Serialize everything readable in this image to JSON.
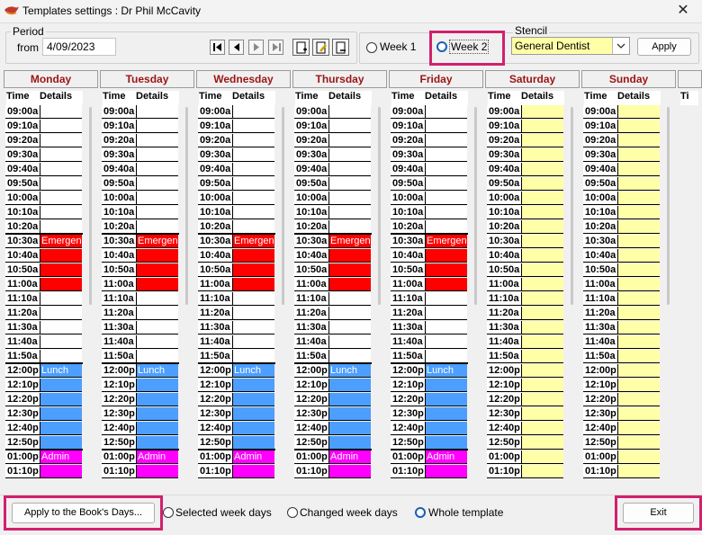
{
  "window": {
    "title": "Templates settings : Dr Phil McCavity",
    "close_glyph": "✕"
  },
  "period": {
    "label": "Period",
    "from_label": "from",
    "from_value": "4/09/2023"
  },
  "week_options": [
    {
      "label": "Week 1",
      "selected": false
    },
    {
      "label": "Week 2",
      "selected": true
    }
  ],
  "stencil": {
    "label": "Stencil",
    "value": "General Dentist",
    "apply_label": "Apply"
  },
  "columns": {
    "time": "Time",
    "details": "Details"
  },
  "days": [
    "Monday",
    "Tuesday",
    "Wednesday",
    "Thursday",
    "Friday",
    "Saturday",
    "Sunday"
  ],
  "partial_day_header": "Ti",
  "times": [
    "09:00a",
    "09:10a",
    "09:20a",
    "09:30a",
    "09:40a",
    "09:50a",
    "10:00a",
    "10:10a",
    "10:20a",
    "10:30a",
    "10:40a",
    "10:50a",
    "11:00a",
    "11:10a",
    "11:20a",
    "11:30a",
    "11:40a",
    "11:50a",
    "12:00p",
    "12:10p",
    "12:20p",
    "12:30p",
    "12:40p",
    "12:50p",
    "01:00p",
    "01:10p"
  ],
  "blocks": [
    {
      "label": "Emergency",
      "start": 9,
      "end": 12,
      "color": "#ff0000"
    },
    {
      "label": "Lunch",
      "start": 18,
      "end": 23,
      "color": "#4d9fff"
    },
    {
      "label": "Admin",
      "start": 24,
      "end": 25,
      "color": "#ff00ff"
    }
  ],
  "colors": {
    "weekday_empty": "#ffffff",
    "weekend_empty": "#ffffa8",
    "day_header_text": "#9b1515",
    "highlight": "#d1206e"
  },
  "bottom": {
    "apply_days_label": "Apply to the Book's Days...",
    "scope_options": [
      {
        "label": "Selected week days",
        "selected": false
      },
      {
        "label": "Changed week days",
        "selected": false
      },
      {
        "label": "Whole template",
        "selected": true
      }
    ],
    "exit_label": "Exit"
  }
}
